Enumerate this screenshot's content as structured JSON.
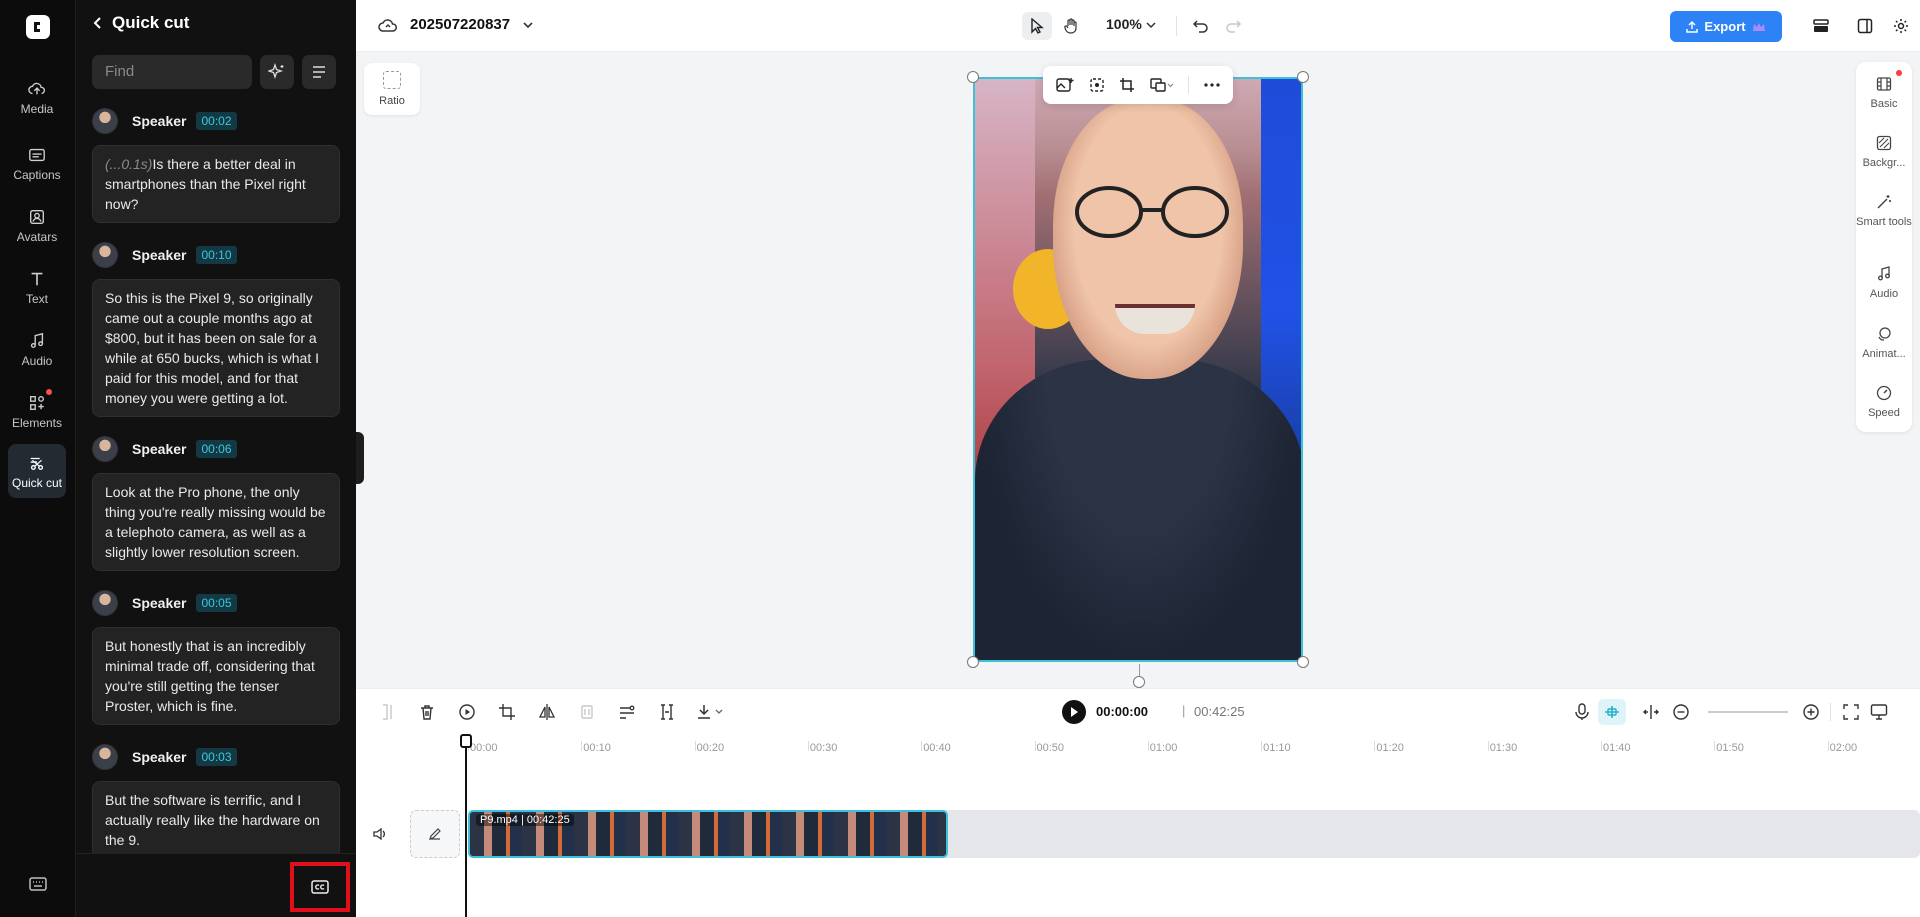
{
  "rail": {
    "items": [
      {
        "label": "Media",
        "icon": "cloud-upload-icon"
      },
      {
        "label": "Captions",
        "icon": "captions-icon"
      },
      {
        "label": "Avatars",
        "icon": "avatar-icon"
      },
      {
        "label": "Text",
        "icon": "text-icon"
      },
      {
        "label": "Audio",
        "icon": "music-note-icon"
      },
      {
        "label": "Elements",
        "icon": "elements-icon"
      },
      {
        "label": "Quick cut",
        "icon": "quick-cut-icon"
      }
    ]
  },
  "panel": {
    "title": "Quick cut",
    "find_placeholder": "Find",
    "segments": [
      {
        "speaker": "Speaker",
        "time": "00:02",
        "prefix": "(...0.1s)",
        "text": "Is there a better deal in smartphones than the Pixel right now?"
      },
      {
        "speaker": "Speaker",
        "time": "00:10",
        "prefix": "",
        "text": "So this is the Pixel 9, so originally came out a couple months ago at $800, but it has been on sale for a while at 650 bucks, which is what I paid for this model, and for that money you were getting a lot."
      },
      {
        "speaker": "Speaker",
        "time": "00:06",
        "prefix": "",
        "text": "Look at the Pro phone, the only thing you're really missing would be a telephoto camera, as well as a slightly lower resolution screen."
      },
      {
        "speaker": "Speaker",
        "time": "00:05",
        "prefix": "",
        "text": "But honestly that is an incredibly minimal trade off, considering that you're still getting the tenser Proster, which is fine."
      },
      {
        "speaker": "Speaker",
        "time": "00:03",
        "prefix": "",
        "text": "But the software is terrific, and I actually really like the hardware on the 9."
      }
    ]
  },
  "topbar": {
    "project_name": "202507220837",
    "zoom": "100%",
    "export_label": "Export"
  },
  "canvas": {
    "ratio_label": "Ratio"
  },
  "props": {
    "items": [
      {
        "label": "Basic"
      },
      {
        "label": "Backgr..."
      },
      {
        "label": "Smart tools"
      },
      {
        "label": "Audio"
      },
      {
        "label": "Animat..."
      },
      {
        "label": "Speed"
      }
    ]
  },
  "timeline": {
    "current_time": "00:00:00",
    "separator": "|",
    "total_time": "00:42:25",
    "ticks": [
      "00:00",
      "00:10",
      "00:20",
      "00:30",
      "00:40",
      "00:50",
      "01:00",
      "01:10",
      "01:20",
      "01:30",
      "01:40",
      "01:50",
      "02:00"
    ],
    "clip_label": "P9.mp4 | 00:42:25"
  },
  "colors": {
    "accent": "#3cc1d9",
    "export": "#2d83f6",
    "highlight": "#e0101a"
  }
}
